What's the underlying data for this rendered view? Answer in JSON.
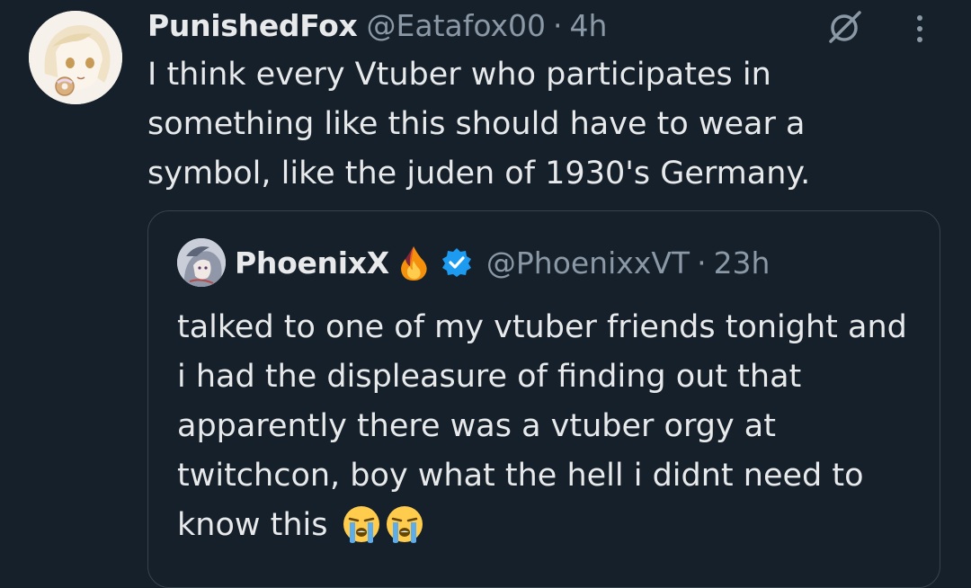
{
  "tweet": {
    "author": {
      "display_name": "PunishedFox",
      "handle": "@Eatafox00",
      "separator": "·",
      "time": "4h"
    },
    "text": "I think every Vtuber who participates in something like this should have to wear a symbol, like the juden of 1930's Germany.",
    "icons": {
      "avatar": "anime-girl-avatar",
      "grok": "grok-icon",
      "more": "more-options-icon"
    }
  },
  "quote": {
    "author": {
      "display_name": "PhoenixX",
      "name_emoji": "fire-icon",
      "verified": "verified-badge-icon",
      "handle": "@PhoenixxVT",
      "separator": "·",
      "time": "23h"
    },
    "text": "talked to one of my vtuber friends tonight and i had the displeasure of finding out that apparently there was a vtuber orgy at twitchcon, boy what the hell i didnt need to know this",
    "trailing_emoji": [
      "loudly-crying-face-icon",
      "loudly-crying-face-icon"
    ]
  },
  "colors": {
    "background": "#15202b",
    "text_primary": "#e7e9ea",
    "text_secondary": "#8b98a5",
    "border": "#38444d",
    "verified_blue": "#1d9bf0"
  }
}
